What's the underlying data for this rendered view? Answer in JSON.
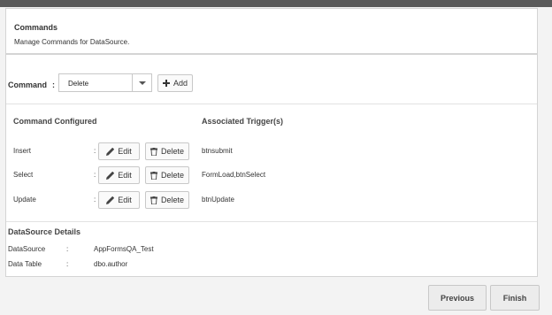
{
  "header": {
    "title": "Commands",
    "description": "Manage Commands for DataSource."
  },
  "command": {
    "label": "Command",
    "colon": ":",
    "selected": "Delete",
    "add_label": "Add"
  },
  "configured": {
    "heading": "Command Configured",
    "trigger_heading": "Associated Trigger(s)",
    "edit_label": "Edit",
    "delete_label": "Delete",
    "rows": [
      {
        "name": "Insert",
        "colon": ":",
        "trigger": "btnsubmit"
      },
      {
        "name": "Select",
        "colon": ":",
        "trigger": "FormLoad,btnSelect"
      },
      {
        "name": "Update",
        "colon": ":",
        "trigger": "btnUpdate"
      }
    ]
  },
  "datasource": {
    "heading": "DataSource Details",
    "items": [
      {
        "label": "DataSource",
        "colon": ":",
        "value": "AppFormsQA_Test"
      },
      {
        "label": "Data Table",
        "colon": ":",
        "value": "dbo.author"
      }
    ]
  },
  "footer": {
    "previous_label": "Previous",
    "finish_label": "Finish"
  },
  "icons": {
    "add": "plus-icon",
    "edit": "pencil-icon",
    "delete": "trash-icon",
    "dropdown": "caret-down-icon"
  }
}
